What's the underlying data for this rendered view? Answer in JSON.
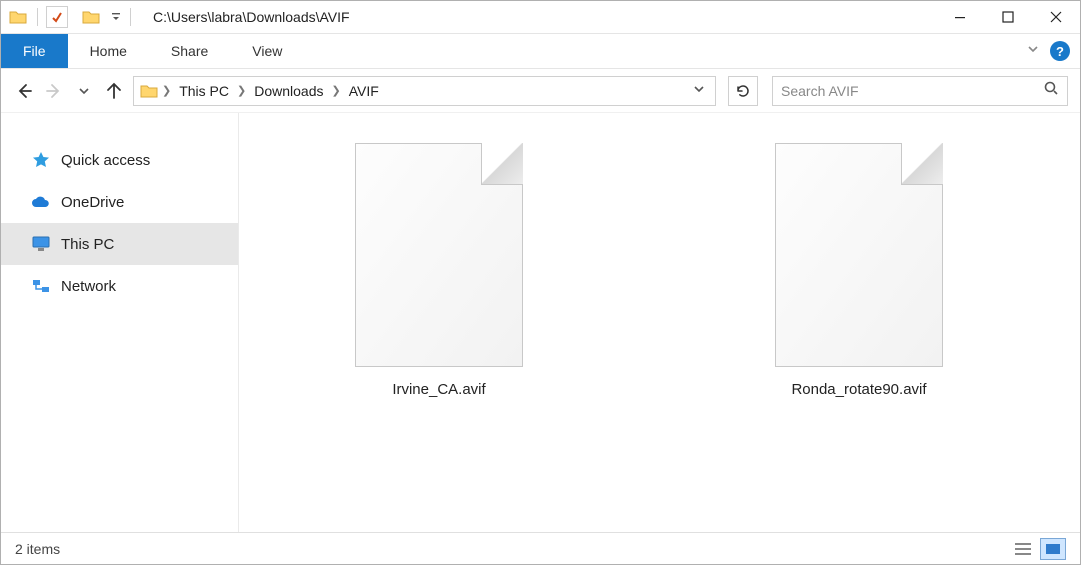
{
  "title_path": "C:\\Users\\labra\\Downloads\\AVIF",
  "ribbon": {
    "file": "File",
    "home": "Home",
    "share": "Share",
    "view": "View"
  },
  "breadcrumbs": [
    "This PC",
    "Downloads",
    "AVIF"
  ],
  "search": {
    "placeholder": "Search AVIF"
  },
  "sidebar": {
    "items": [
      {
        "label": "Quick access"
      },
      {
        "label": "OneDrive"
      },
      {
        "label": "This PC"
      },
      {
        "label": "Network"
      }
    ]
  },
  "files": [
    {
      "name": "Irvine_CA.avif"
    },
    {
      "name": "Ronda_rotate90.avif"
    }
  ],
  "status": {
    "count_text": "2 items"
  }
}
